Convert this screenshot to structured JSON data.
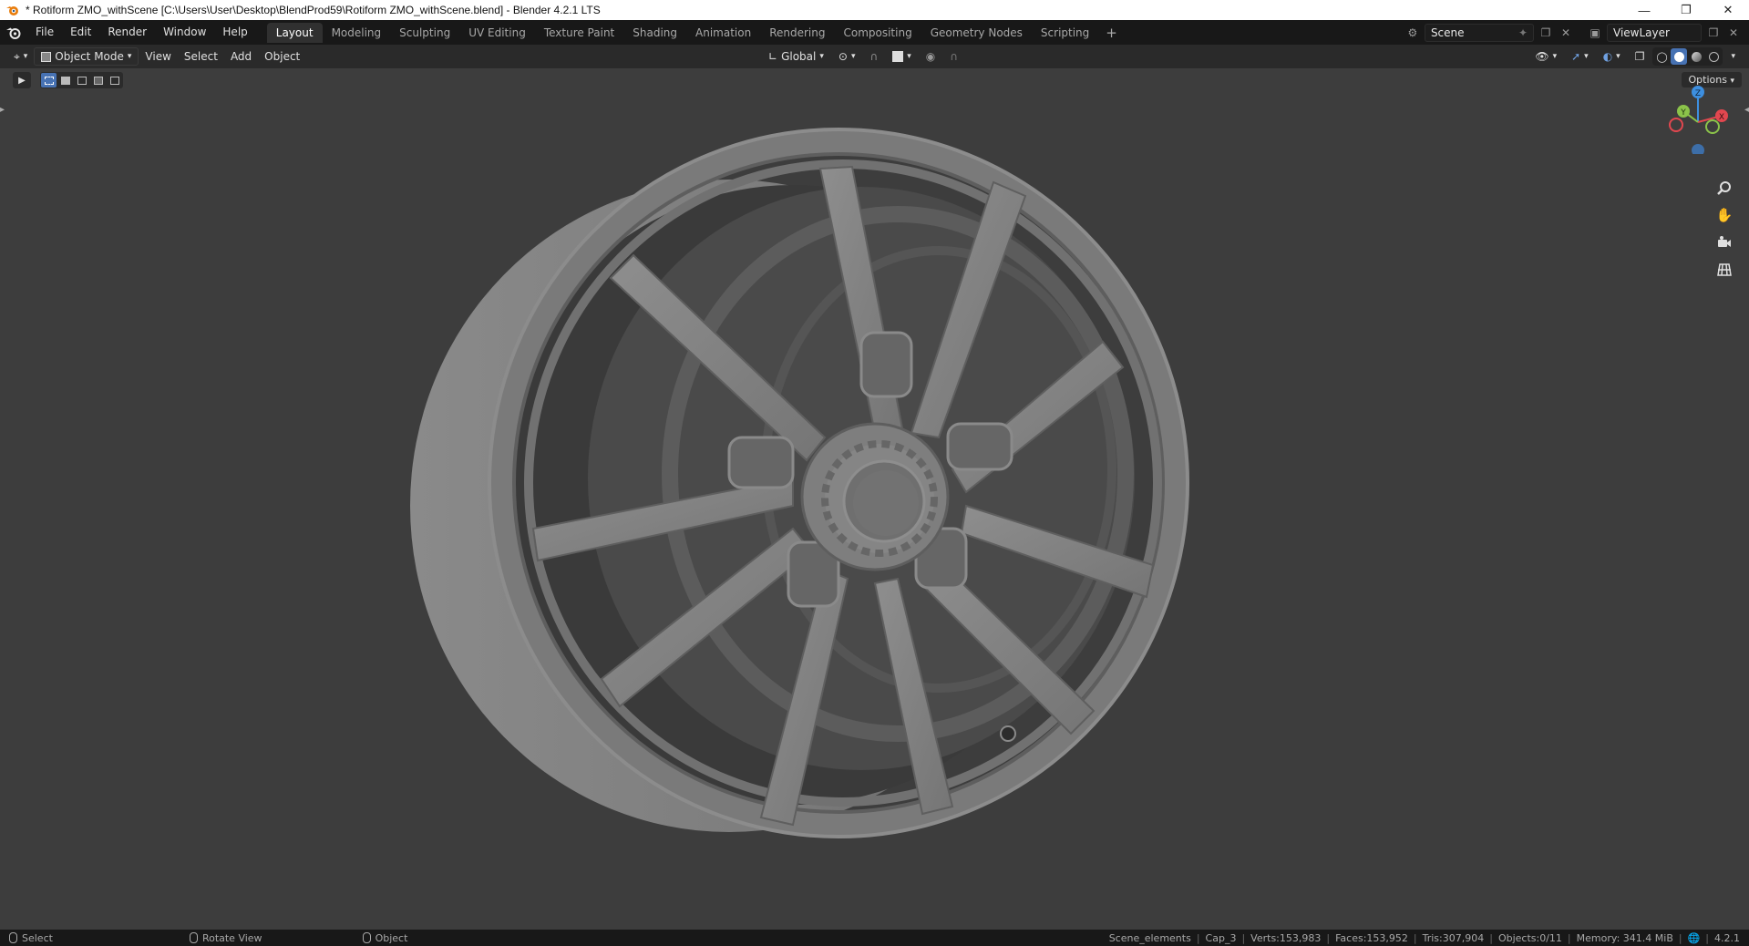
{
  "window": {
    "title": "* Rotiform ZMO_withScene [C:\\Users\\User\\Desktop\\BlendProd59\\Rotiform ZMO_withScene.blend] - Blender 4.2.1 LTS"
  },
  "menu": [
    "File",
    "Edit",
    "Render",
    "Window",
    "Help"
  ],
  "workspaces": [
    {
      "label": "Layout",
      "active": true
    },
    {
      "label": "Modeling",
      "active": false
    },
    {
      "label": "Sculpting",
      "active": false
    },
    {
      "label": "UV Editing",
      "active": false
    },
    {
      "label": "Texture Paint",
      "active": false
    },
    {
      "label": "Shading",
      "active": false
    },
    {
      "label": "Animation",
      "active": false
    },
    {
      "label": "Rendering",
      "active": false
    },
    {
      "label": "Compositing",
      "active": false
    },
    {
      "label": "Geometry Nodes",
      "active": false
    },
    {
      "label": "Scripting",
      "active": false
    }
  ],
  "scene": {
    "name": "Scene"
  },
  "view_layer": {
    "name": "ViewLayer"
  },
  "viewport_header": {
    "mode": "Object Mode",
    "menus": [
      "View",
      "Select",
      "Add",
      "Object"
    ],
    "transform_orientation": "Global"
  },
  "viewport": {
    "options_label": "Options",
    "gizmo_axes": {
      "z": "Z",
      "y": "Y",
      "x": "X"
    }
  },
  "statusbar": {
    "hints": [
      {
        "icon": "mouse-left-icon",
        "label": "Select"
      },
      {
        "icon": "mouse-middle-icon",
        "label": "Rotate View"
      },
      {
        "icon": "mouse-right-icon",
        "label": "Object"
      }
    ],
    "collection": "Scene_elements",
    "active_object": "Cap_3",
    "verts": "Verts:153,983",
    "faces": "Faces:153,952",
    "tris": "Tris:307,904",
    "objects": "Objects:0/11",
    "memory": "Memory: 341.4 MiB",
    "version": "4.2.1"
  },
  "colors": {
    "accent": "#4772b3",
    "viewport_bg": "#3d3d3d",
    "axis_x": "#e2474f",
    "axis_y": "#8bc34a",
    "axis_z": "#3d8fe0"
  }
}
